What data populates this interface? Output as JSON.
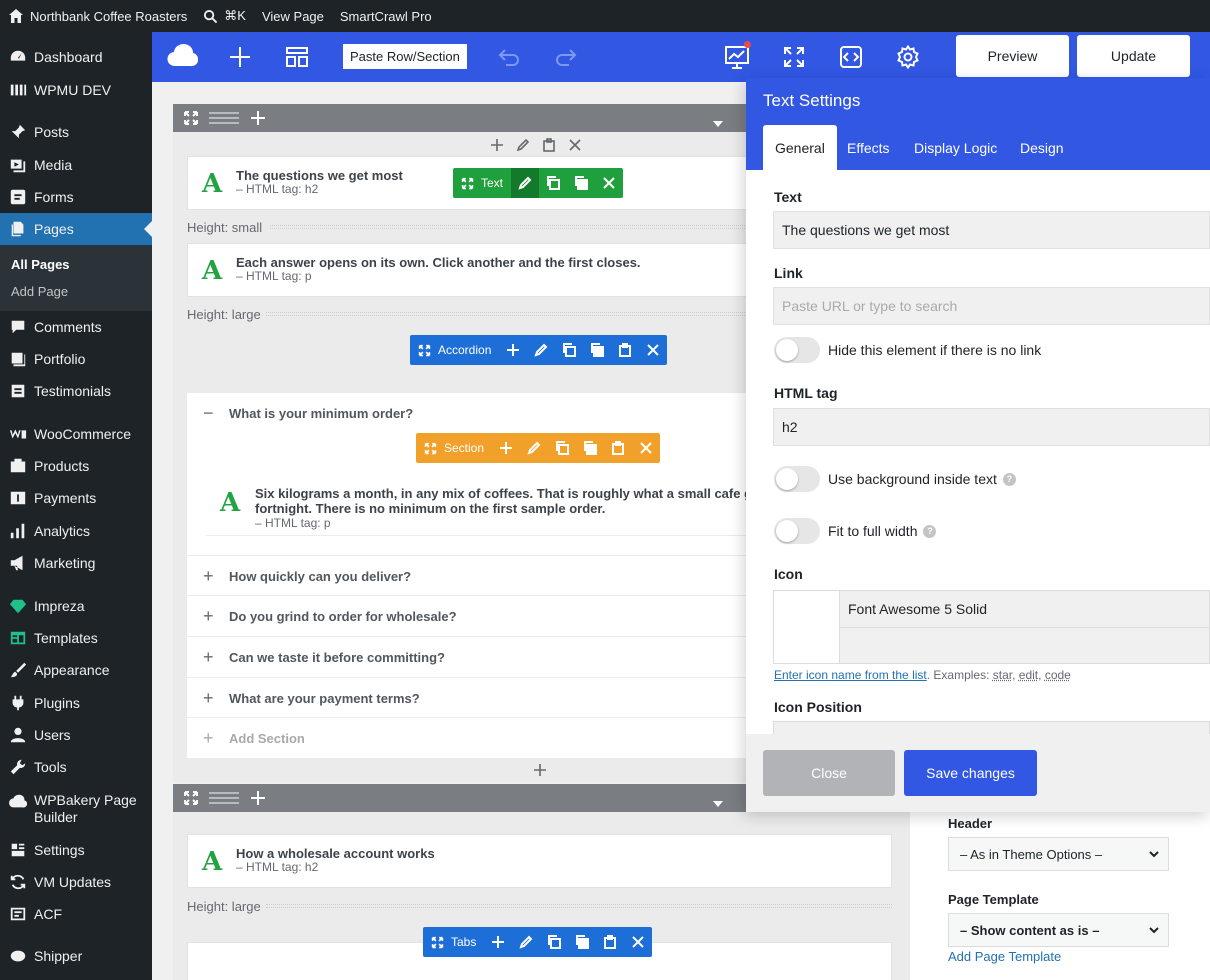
{
  "adminbar": {
    "site_name": "Northbank Coffee Roasters",
    "shortcut": "⌘K",
    "view_page": "View Page",
    "plugin": "SmartCrawl Pro"
  },
  "sidebar": {
    "items": [
      {
        "label": "Dashboard",
        "icon": "dashboard-icon"
      },
      {
        "label": "WPMU DEV",
        "icon": "wpmudev-icon"
      },
      {
        "label": "Posts",
        "icon": "pin-icon"
      },
      {
        "label": "Media",
        "icon": "media-icon"
      },
      {
        "label": "Forms",
        "icon": "forms-icon"
      },
      {
        "label": "Pages",
        "icon": "pages-icon"
      },
      {
        "label": "Comments",
        "icon": "comments-icon"
      },
      {
        "label": "Portfolio",
        "icon": "portfolio-icon"
      },
      {
        "label": "Testimonials",
        "icon": "testimonials-icon"
      },
      {
        "label": "WooCommerce",
        "icon": "woocommerce-icon"
      },
      {
        "label": "Products",
        "icon": "products-icon"
      },
      {
        "label": "Payments",
        "icon": "payments-icon"
      },
      {
        "label": "Analytics",
        "icon": "analytics-icon"
      },
      {
        "label": "Marketing",
        "icon": "marketing-icon"
      },
      {
        "label": "Impreza",
        "icon": "diamond-icon"
      },
      {
        "label": "Templates",
        "icon": "templates-icon"
      },
      {
        "label": "Appearance",
        "icon": "brush-icon"
      },
      {
        "label": "Plugins",
        "icon": "plug-icon"
      },
      {
        "label": "Users",
        "icon": "users-icon"
      },
      {
        "label": "Tools",
        "icon": "wrench-icon"
      },
      {
        "label": "WPBakery Page Builder",
        "icon": "wpbakery-icon"
      },
      {
        "label": "Settings",
        "icon": "settings-icon"
      },
      {
        "label": "VM Updates",
        "icon": "refresh-icon"
      },
      {
        "label": "ACF",
        "icon": "acf-icon"
      },
      {
        "label": "Shipper",
        "icon": "shipper-icon"
      }
    ],
    "submenu": [
      "All Pages",
      "Add Page"
    ]
  },
  "builder": {
    "paste_label": "Paste Row/Section",
    "preview_label": "Preview",
    "update_label": "Update"
  },
  "canvas": {
    "el1_title": "The questions we get most",
    "el1_sub": "– HTML tag: h2",
    "el1_ctl": "Text",
    "spacer1": "Height: small",
    "el2_title": "Each answer opens on its own. Click another and the first closes.",
    "el2_sub": "– HTML tag: p",
    "spacer2": "Height: large",
    "accordion_ctl": "Accordion",
    "section_ctl": "Section",
    "acc_open_title": "What is your minimum order?",
    "acc_open_body_1": "Six kilograms a month, in any mix of coffees. That is roughly what a small cafe gets through in a",
    "acc_open_body_2": "fortnight. There is no minimum on the first sample order.",
    "acc_open_sub": "– HTML tag: p",
    "acc_items": [
      "How quickly can you deliver?",
      "Do you grind to order for wholesale?",
      "Can we taste it before committing?",
      "What are your payment terms?"
    ],
    "add_section": "Add Section",
    "el3_title": "How a wholesale account works",
    "el3_sub": "– HTML tag: h2",
    "spacer3": "Height: large",
    "tabs_ctl": "Tabs"
  },
  "page_settings": {
    "header_label": "Header",
    "header_value": "– As in Theme Options –",
    "template_label": "Page Template",
    "template_value": "– Show content as is –",
    "template_link": "Add Page Template"
  },
  "panel": {
    "title": "Text Settings",
    "tabs": [
      "General",
      "Effects",
      "Display Logic",
      "Design"
    ],
    "text_label": "Text",
    "text_value": "The questions we get most",
    "link_label": "Link",
    "link_placeholder": "Paste URL or type to search",
    "hide_label": "Hide this element if there is no link",
    "tag_label": "HTML tag",
    "tag_value": "h2",
    "bg_label": "Use background inside text",
    "fit_label": "Fit to full width",
    "icon_label": "Icon",
    "icon_set": "Font Awesome 5 Solid",
    "icon_help_link": "Enter icon name from the list",
    "icon_help_text": ". Examples: ",
    "icon_examples": [
      "star",
      "edit",
      "code"
    ],
    "icon_position_label": "Icon Position",
    "close_label": "Close",
    "save_label": "Save changes"
  },
  "colors": {
    "accent": "#3157e3",
    "wp_blue": "#2271b1",
    "element_green": "#23a243",
    "control_blue": "#1e6ed8",
    "control_orange": "#f1a02a"
  }
}
